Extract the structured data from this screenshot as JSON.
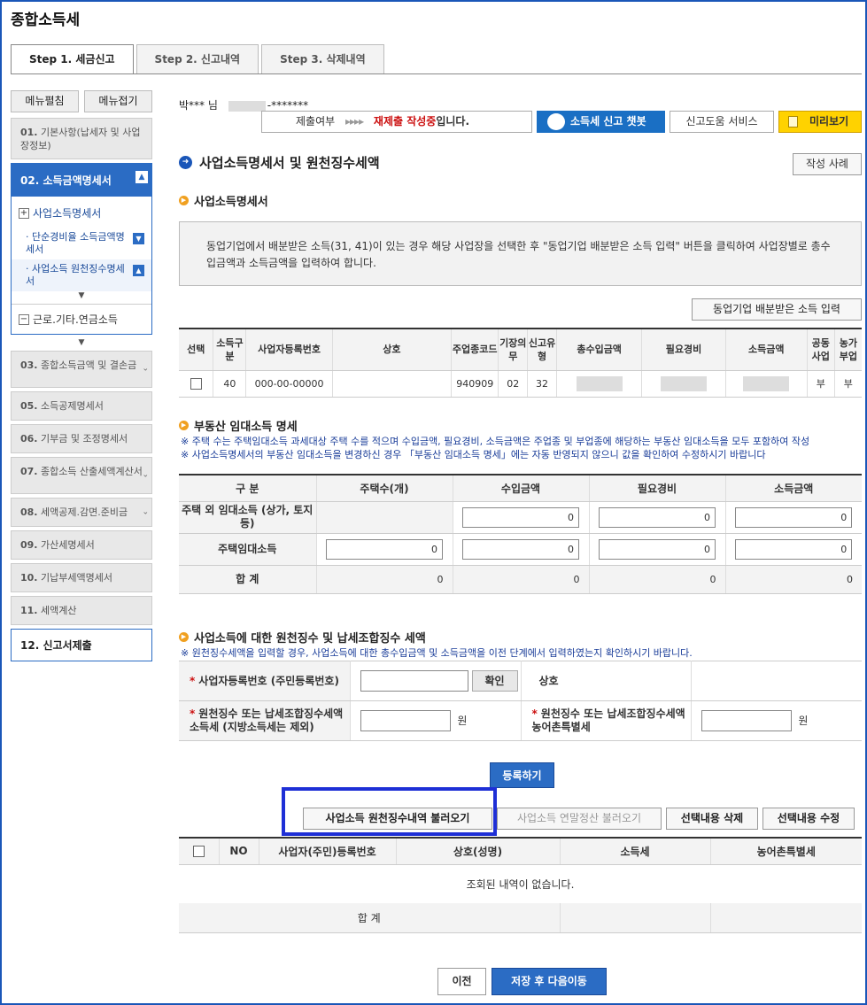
{
  "app": {
    "title": "종합소득세"
  },
  "steps": [
    {
      "label": "Step 1. 세금신고"
    },
    {
      "label": "Step 2. 신고내역"
    },
    {
      "label": "Step 3. 삭제내역"
    }
  ],
  "sidebar": {
    "expand_all": "메뉴펼침",
    "collapse_all": "메뉴접기",
    "item01": {
      "num": "01.",
      "label": "기본사항(납세자 및 사업장정보)"
    },
    "item02": {
      "num": "02.",
      "label": "소득금액명세서"
    },
    "sub_head": "사업소득명세서",
    "sub1": "단순경비율 소득금액명세서",
    "sub2": "사업소득 원천징수명세서",
    "sub_collapsed": "근로.기타.연금소득",
    "item03": {
      "num": "03.",
      "label": "종합소득금액 및 결손금"
    },
    "item05": {
      "num": "05.",
      "label": "소득공제명세서"
    },
    "item06": {
      "num": "06.",
      "label": "기부금 및 조정명세서"
    },
    "item07": {
      "num": "07.",
      "label": "종합소득 산출세액계산서"
    },
    "item08": {
      "num": "08.",
      "label": "세액공제.감면.준비금"
    },
    "item09": {
      "num": "09.",
      "label": "가산세명세서"
    },
    "item10": {
      "num": "10.",
      "label": "기납부세액명세서"
    },
    "item11": {
      "num": "11.",
      "label": "세액계산"
    },
    "item12": {
      "num": "12.",
      "label": "신고서제출"
    }
  },
  "header": {
    "user_name": "박*** 님",
    "user_id_suffix": "-*******",
    "status_label": "제출여부",
    "status_arrows": "▸▸▸▸",
    "status_value": "재제출 작성중",
    "status_suffix": "입니다.",
    "chatbot": "소득세 신고 챗봇",
    "help": "신고도움 서비스",
    "preview": "미리보기"
  },
  "section": {
    "title": "사업소득명세서 및 원천징수세액",
    "example_btn": "작성 사례"
  },
  "biz": {
    "title": "사업소득명세서",
    "info": "동업기업에서 배분받은 소득(31, 41)이 있는 경우 해당 사업장을 선택한 후 \"동업기업 배분받은 소득 입력\" 버튼을 클릭하여 사업장별로 총수입금액과 소득금액을 입력하여 합니다.",
    "partner_btn": "동업기업 배분받은 소득 입력",
    "headers": [
      "선택",
      "소득구분",
      "사업자등록번호",
      "상호",
      "주업종코드",
      "기장의무",
      "신고유형",
      "총수입금액",
      "필요경비",
      "소득금액",
      "공동사업",
      "농가부업"
    ],
    "row": {
      "type": "40",
      "reg_no": "000-00-00000",
      "name": "",
      "code": "940909",
      "duty": "02",
      "report": "32",
      "joint": "부",
      "farm": "부"
    }
  },
  "rent": {
    "title": "부동산 임대소득 명세",
    "note1": "※ 주택 수는 주택임대소득 과세대상 주택 수를 적으며 수입금액, 필요경비, 소득금액은 주업종 및 부업종에 해당하는 부동산 임대소득을 모두 포함하여 작성",
    "note2": "※ 사업소득명세서의 부동산 임대소득을 변경하신 경우 「부동산 임대소득 명세」에는 자동 반영되지 않으니 값을 확인하여 수정하시기 바랍니다",
    "headers": [
      "구 분",
      "주택수(개)",
      "수입금액",
      "필요경비",
      "소득금액"
    ],
    "rows": [
      {
        "label": "주택 외 임대소득 (상가, 토지 등)",
        "count": "",
        "income": "0",
        "expense": "0",
        "net": "0"
      },
      {
        "label": "주택임대소득",
        "count": "0",
        "income": "0",
        "expense": "0",
        "net": "0"
      }
    ],
    "total": {
      "label": "합 계",
      "count": "0",
      "income": "0",
      "expense": "0",
      "net": "0"
    }
  },
  "withhold": {
    "title": "사업소득에 대한 원천징수 및 납세조합징수 세액",
    "note": "※ 원천징수세액을 입력할 경우, 사업소득에 대한 총수입금액 및 소득금액을 이전 단계에서 입력하였는지 확인하시기 바랍니다.",
    "reg_label": "사업자등록번호 (주민등록번호)",
    "confirm": "확인",
    "name_label": "상호",
    "tax_label": "원천징수 또는 납세조합징수세액 소득세 (지방소득세는 제외)",
    "won": "원",
    "rural_label": "원천징수 또는 납세조합징수세액 농어촌특별세",
    "register": "등록하기",
    "load_withhold": "사업소득 원천징수내역 불러오기",
    "load_yearend": "사업소득 연말정산 불러오기",
    "delete_sel": "선택내용 삭제",
    "edit_sel": "선택내용 수정",
    "headers": [
      "NO",
      "사업자(주민)등록번호",
      "상호(성명)",
      "소득세",
      "농어촌특별세"
    ],
    "empty": "조회된 내역이 없습니다.",
    "total": "합 계"
  },
  "footer": {
    "prev": "이전",
    "next": "저장 후 다음이동"
  }
}
